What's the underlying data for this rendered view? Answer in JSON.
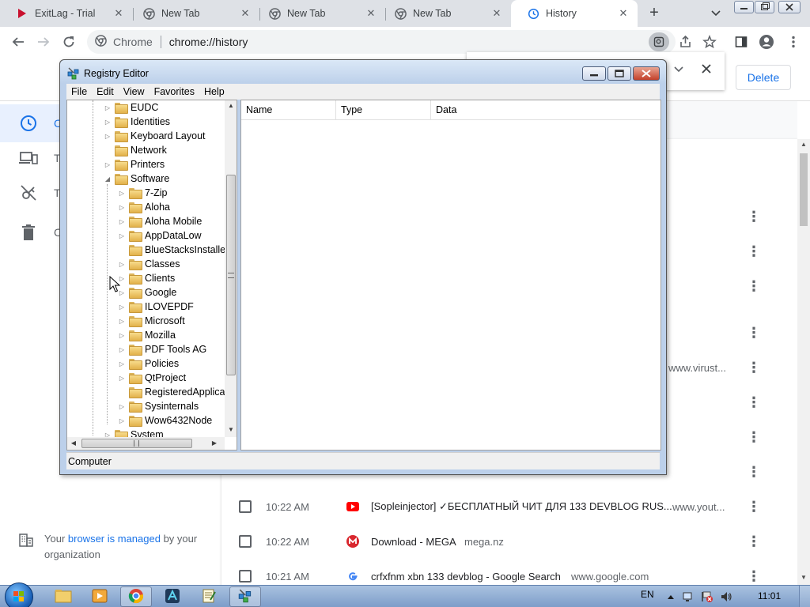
{
  "browser": {
    "tabs": [
      {
        "title": "ExitLag - Trial",
        "favicon": "exitlag-icon"
      },
      {
        "title": "New Tab",
        "favicon": "chrome-icon"
      },
      {
        "title": "New Tab",
        "favicon": "chrome-icon"
      },
      {
        "title": "New Tab",
        "favicon": "chrome-icon"
      },
      {
        "title": "History",
        "favicon": "history-icon",
        "active": true
      }
    ],
    "omnibox": {
      "site_label": "Chrome",
      "url": "chrome://history"
    }
  },
  "history": {
    "delete_label": "Delete",
    "sidebar": [
      {
        "label": "C",
        "icon": "clock-icon",
        "active": true
      },
      {
        "label": "T",
        "icon": "devices-icon"
      },
      {
        "label": "T",
        "icon": "tabs-off-icon"
      },
      {
        "label": "C",
        "icon": "trash-icon"
      }
    ],
    "managed": {
      "prefix": "Your ",
      "link": "browser is managed",
      "suffix": " by your organization"
    },
    "rows": [
      {
        "time": "10:22 AM",
        "title": "[Sopleinjector] ✓БЕСПЛАТНЫЙ ЧИТ ДЛЯ 133 DEVBLOG RUS...",
        "domain": "www.yout...",
        "favicon": "youtube-icon"
      },
      {
        "time": "10:22 AM",
        "title": "Download - MEGA",
        "domain": "mega.nz",
        "favicon": "mega-icon"
      },
      {
        "time": "10:21 AM",
        "title": "crfxfnm xbn 133 devblog - Google Search",
        "domain": "www.google.com",
        "favicon": "google-icon"
      }
    ],
    "partial_domain": "www.virust..."
  },
  "regedit": {
    "title": "Registry Editor",
    "menu": [
      "File",
      "Edit",
      "View",
      "Favorites",
      "Help"
    ],
    "tree_top": [
      "EUDC",
      "Identities",
      "Keyboard Layout",
      "Network",
      "Printers",
      "Software"
    ],
    "tree_software": [
      "7-Zip",
      "Aloha",
      "Aloha Mobile",
      "AppDataLow",
      "BlueStacksInstaller",
      "Classes",
      "Clients",
      "Google",
      "ILOVEPDF",
      "Microsoft",
      "Mozilla",
      "PDF Tools AG",
      "Policies",
      "QtProject",
      "RegisteredApplica",
      "Sysinternals",
      "Wow6432Node"
    ],
    "tree_after": "System",
    "columns": [
      "Name",
      "Type",
      "Data"
    ],
    "status": "Computer"
  },
  "taskbar": {
    "lang": "EN",
    "clock": "11:01"
  }
}
